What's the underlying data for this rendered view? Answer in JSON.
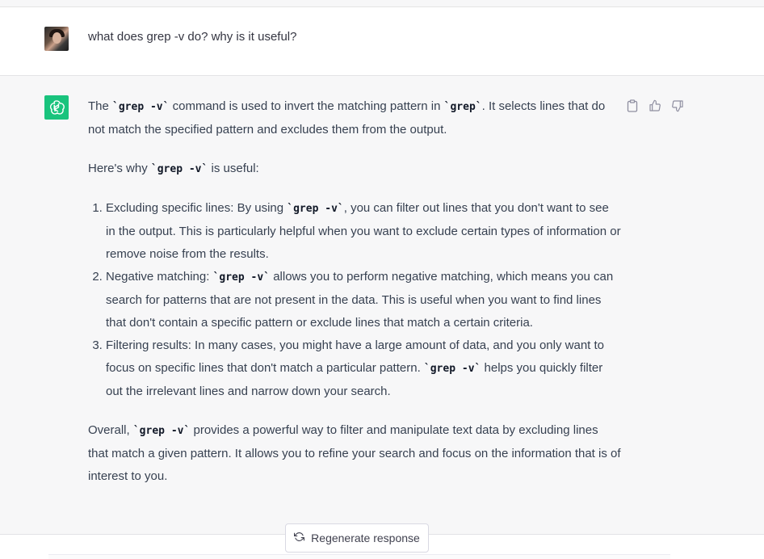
{
  "user_message": {
    "text": "what does grep -v do? why is it useful?"
  },
  "assistant_message": {
    "p1": {
      "a": "The ",
      "code1": "`grep -v`",
      "b": " command is used to invert the matching pattern in ",
      "code2": "`grep`",
      "c": ". It selects lines that do not match the specified pattern and excludes them from the output."
    },
    "p2": {
      "a": "Here's why ",
      "code": "`grep -v`",
      "b": " is useful:"
    },
    "list": [
      {
        "a": "Excluding specific lines: By using ",
        "code": "`grep -v`",
        "b": ", you can filter out lines that you don't want to see in the output. This is particularly helpful when you want to exclude certain types of information or remove noise from the results."
      },
      {
        "a": "Negative matching: ",
        "code": "`grep -v`",
        "b": " allows you to perform negative matching, which means you can search for patterns that are not present in the data. This is useful when you want to find lines that don't contain a specific pattern or exclude lines that match a certain criteria."
      },
      {
        "a": "Filtering results: In many cases, you might have a large amount of data, and you only want to focus on specific lines that don't match a particular pattern. ",
        "code": "`grep -v`",
        "b": " helps you quickly filter out the irrelevant lines and narrow down your search."
      }
    ],
    "p3": {
      "a": "Overall, ",
      "code": "`grep -v`",
      "b": " provides a powerful way to filter and manipulate text data by excluding lines that match a given pattern. It allows you to refine your search and focus on the information that is of interest to you."
    }
  },
  "actions": {
    "icons": [
      "clipboard-icon",
      "thumbs-up-icon",
      "thumbs-down-icon"
    ]
  },
  "regenerate": {
    "label": "Regenerate response"
  },
  "colors": {
    "assistant_bg": "#f7f7f8",
    "brand_green": "#19c37d",
    "text": "#374151"
  }
}
